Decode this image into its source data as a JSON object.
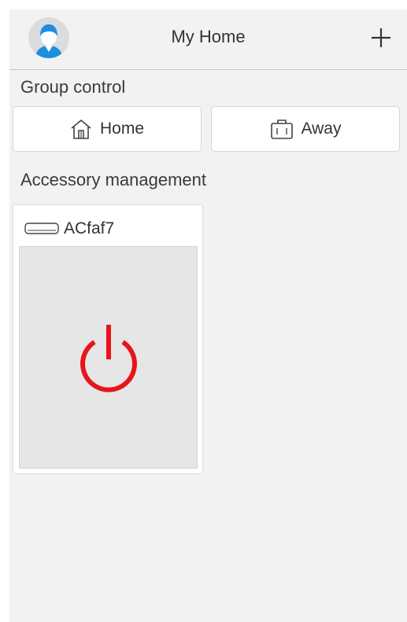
{
  "header": {
    "title": "My Home",
    "avatar_icon": "user-avatar-icon",
    "add_icon": "plus-icon"
  },
  "group_control": {
    "title": "Group control",
    "buttons": [
      {
        "label": "Home",
        "icon": "house-icon"
      },
      {
        "label": "Away",
        "icon": "suitcase-icon"
      }
    ]
  },
  "accessory_management": {
    "title": "Accessory management",
    "devices": [
      {
        "name": "ACfaf7",
        "icon": "air-conditioner-icon",
        "power_icon": "power-icon"
      }
    ]
  },
  "colors": {
    "background": "#f2f2f2",
    "avatar_blue": "#1e8fe0",
    "power_red": "#e8141c"
  }
}
